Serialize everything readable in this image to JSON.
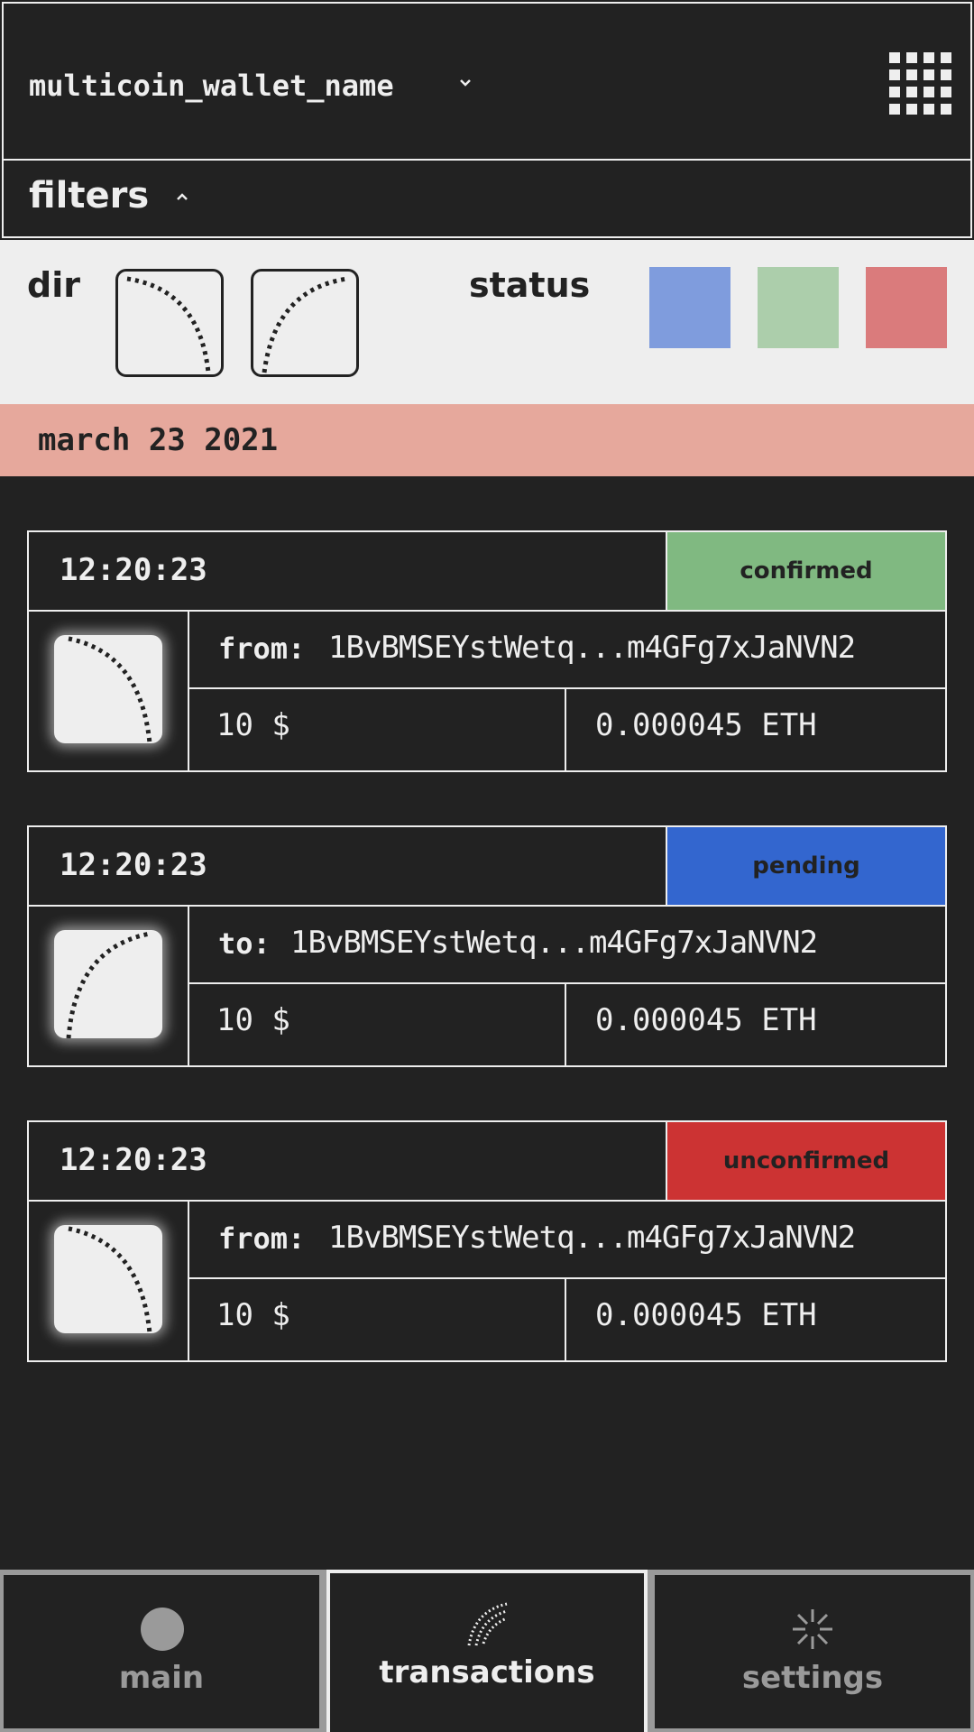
{
  "header": {
    "wallet_name": "multicoin_wallet_name",
    "chevron_icon": "chevron-down-icon",
    "menu_icon": "grid-menu-icon"
  },
  "filters": {
    "label": "filters",
    "chevron_icon": "chevron-up-icon",
    "dir_label": "dir",
    "status_label": "status",
    "dir_options": [
      "incoming-arc-icon",
      "outgoing-arc-icon"
    ],
    "status_colors": [
      "#7f9cdd",
      "#acceab",
      "#da7b7c"
    ]
  },
  "date_label": "march 23 2021",
  "transactions": [
    {
      "time": "12:20:23",
      "status": "confirmed",
      "status_color": "#80b981",
      "direction": "from:",
      "address": "1BvBMSEYstWetq...m4GFg7xJaNVN2",
      "fiat": "10 $",
      "crypto": "0.000045 ETH"
    },
    {
      "time": "12:20:23",
      "status": "pending",
      "status_color": "#3366cf",
      "direction": "to:",
      "address": "1BvBMSEYstWetq...m4GFg7xJaNVN2",
      "fiat": "10 $",
      "crypto": "0.000045 ETH"
    },
    {
      "time": "12:20:23",
      "status": "unconfirmed",
      "status_color": "#cc3333",
      "direction": "from:",
      "address": "1BvBMSEYstWetq...m4GFg7xJaNVN2",
      "fiat": "10 $",
      "crypto": "0.000045 ETH"
    }
  ],
  "nav": {
    "items": [
      {
        "label": "main",
        "icon": "circle-icon"
      },
      {
        "label": "transactions",
        "icon": "dotted-arc-icon"
      },
      {
        "label": "settings",
        "icon": "sparkle-icon"
      }
    ],
    "active": "transactions"
  }
}
